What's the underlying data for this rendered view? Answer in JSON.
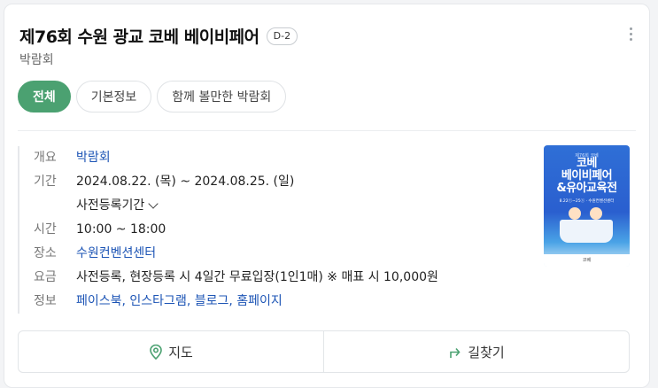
{
  "card": {
    "title": "제76회 수원 광교 코베 베이비페어",
    "dday": "D-2",
    "category": "박람회"
  },
  "tabs": [
    {
      "label": "전체",
      "active": true
    },
    {
      "label": "기본정보",
      "active": false
    },
    {
      "label": "함께 볼만한 박람회",
      "active": false
    }
  ],
  "info": {
    "overview": {
      "key": "개요",
      "value": "박람회"
    },
    "period": {
      "key": "기간",
      "value": "2024.08.22. (목) ~  2024.08.25. (일)",
      "sub": "사전등록기간"
    },
    "time": {
      "key": "시간",
      "value": "10:00 ~ 18:00"
    },
    "place": {
      "key": "장소",
      "value": "수원컨벤션센터"
    },
    "fee": {
      "key": "요금",
      "value": "사전등록, 현장등록 시 4일간 무료입장(1인1매) ※ 매표 시 10,000원"
    },
    "links": {
      "key": "정보",
      "value": "페이스북, 인스타그램, 블로그, 홈페이지"
    }
  },
  "poster": {
    "top_text": "제76회 코베",
    "title_lines": [
      "코베",
      "베이비페어",
      "&유아교육전"
    ],
    "date_text": "8.22ⓣ~25ⓢ · 수원컨벤션센터",
    "footer_text": "코베"
  },
  "actions": {
    "map_label": "지도",
    "directions_label": "길찾기"
  },
  "colors": {
    "accent": "#4ba171",
    "link": "#1c54b5"
  }
}
